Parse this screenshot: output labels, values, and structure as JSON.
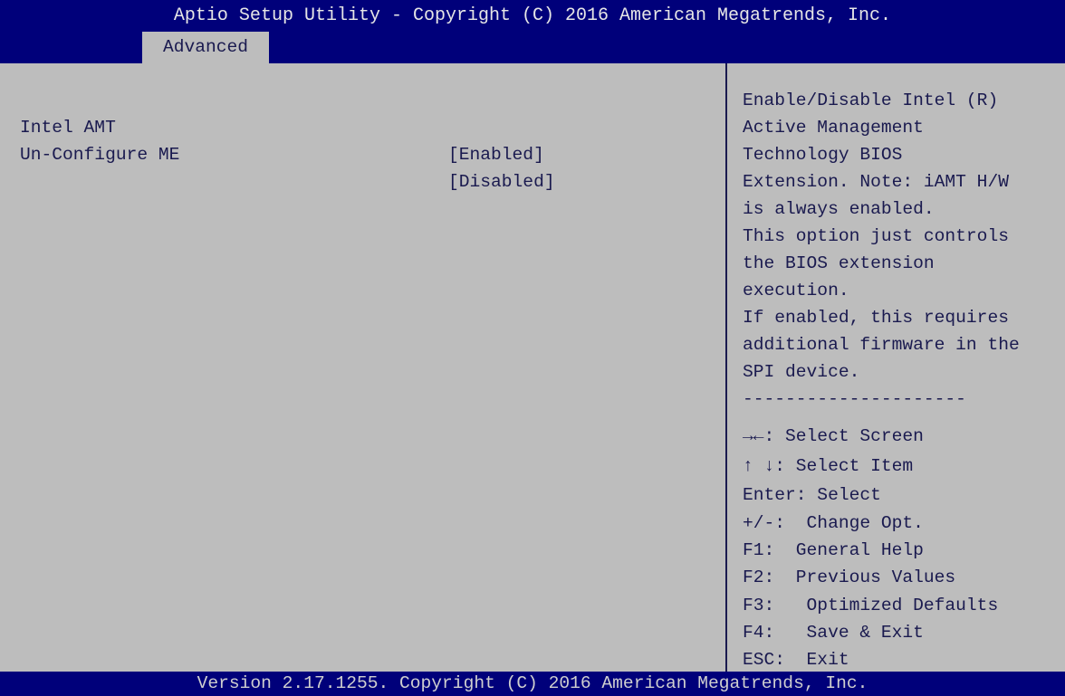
{
  "header": {
    "title": "Aptio Setup Utility - Copyright (C) 2016 American Megatrends, Inc.",
    "active_tab": "Advanced"
  },
  "settings": [
    {
      "label": "Intel AMT",
      "value": "[Enabled]"
    },
    {
      "label": "Un-Configure ME",
      "value": "[Disabled]"
    }
  ],
  "help": {
    "description": [
      "Enable/Disable Intel (R)",
      "Active Management",
      "Technology BIOS",
      "Extension. Note: iAMT H/W",
      "is always enabled.",
      "This option just controls",
      "the BIOS extension",
      "execution.",
      "If enabled, this requires",
      "additional firmware in the",
      "SPI device."
    ],
    "separator": "---------------------",
    "keys": [
      "→←: Select Screen",
      "↑ ↓: Select Item",
      "Enter: Select",
      "+/-:  Change Opt.",
      "F1:  General Help",
      "F2:  Previous Values",
      "F3:   Optimized Defaults",
      "F4:   Save & Exit",
      "ESC:  Exit"
    ]
  },
  "footer": {
    "version": "Version 2.17.1255. Copyright (C) 2016 American Megatrends, Inc."
  },
  "colors": {
    "header_bg": "#00007a",
    "panel_bg": "#bdbdbd",
    "text": "#1a1a4f",
    "header_text": "#e6e6e6"
  }
}
